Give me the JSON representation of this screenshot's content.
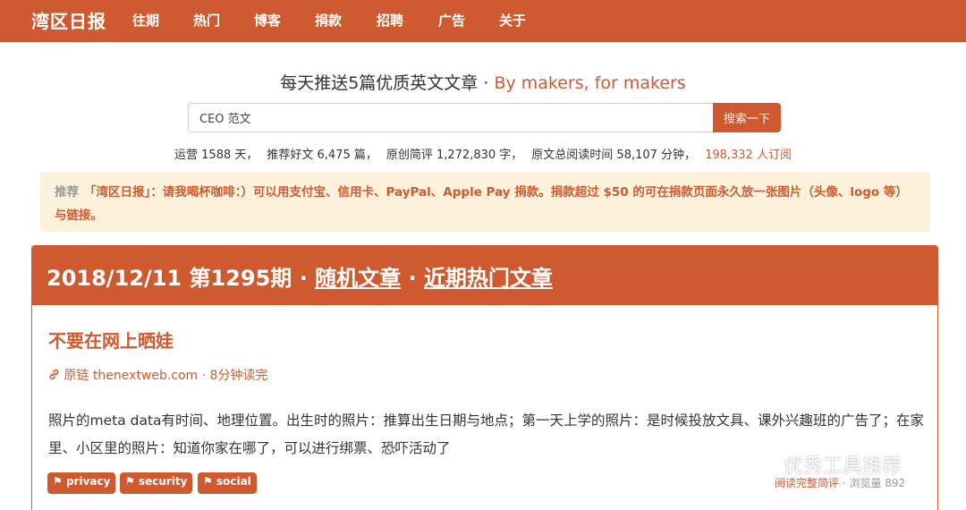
{
  "navbar": {
    "brand": "湾区日报",
    "links": [
      "往期",
      "热门",
      "博客",
      "捐款",
      "招聘",
      "广告",
      "关于"
    ]
  },
  "tagline": {
    "main": "每天推送5篇优质英文文章 · ",
    "accent": "By makers, for makers"
  },
  "search": {
    "value": "CEO 范文",
    "button_label": "搜索一下"
  },
  "stats": {
    "running": "运营 1588 天，",
    "recommended": "推荐好文 6,475 篇，",
    "comments": "原创简评 1,272,830 字，",
    "reading": "原文总阅读时间 58,107 分钟，",
    "subscribers": "198,332 人订阅"
  },
  "alert": {
    "label": "推荐",
    "message": "「湾区日报」：请我喝杯咖啡：）可以用支付宝、信用卡、PayPal、Apple Pay 捐款。捐款超过 $50 的可在捐款页面永久放一张图片（头像、logo 等）与链接。"
  },
  "issue": {
    "title": "2018/12/11 第1295期 · ",
    "random_link": "随机文章",
    "separator": " · ",
    "hot_link": "近期热门文章"
  },
  "article": {
    "title": "不要在网上晒娃",
    "link_icon": "link-icon",
    "source_label": "原链",
    "source_domain": "thenextweb.com",
    "read_time": " · 8分钟读完",
    "body": "照片的meta data有时间、地理位置。出生时的照片：推算出生日期与地点；第一天上学的照片：是时候投放文具、课外兴趣班的广告了；在家里、小区里的照片：知道你家在哪了，可以进行绑票、恐吓活动了",
    "tags": [
      "privacy",
      "security",
      "social"
    ],
    "read_full": "阅读完整简评",
    "views": " · 浏览量 892"
  },
  "watermark": {
    "icon": "wechat-icon",
    "text": "优秀工具推荐"
  },
  "colors": {
    "accent": "#cf5a30",
    "alert_bg": "#fcf2dc"
  }
}
